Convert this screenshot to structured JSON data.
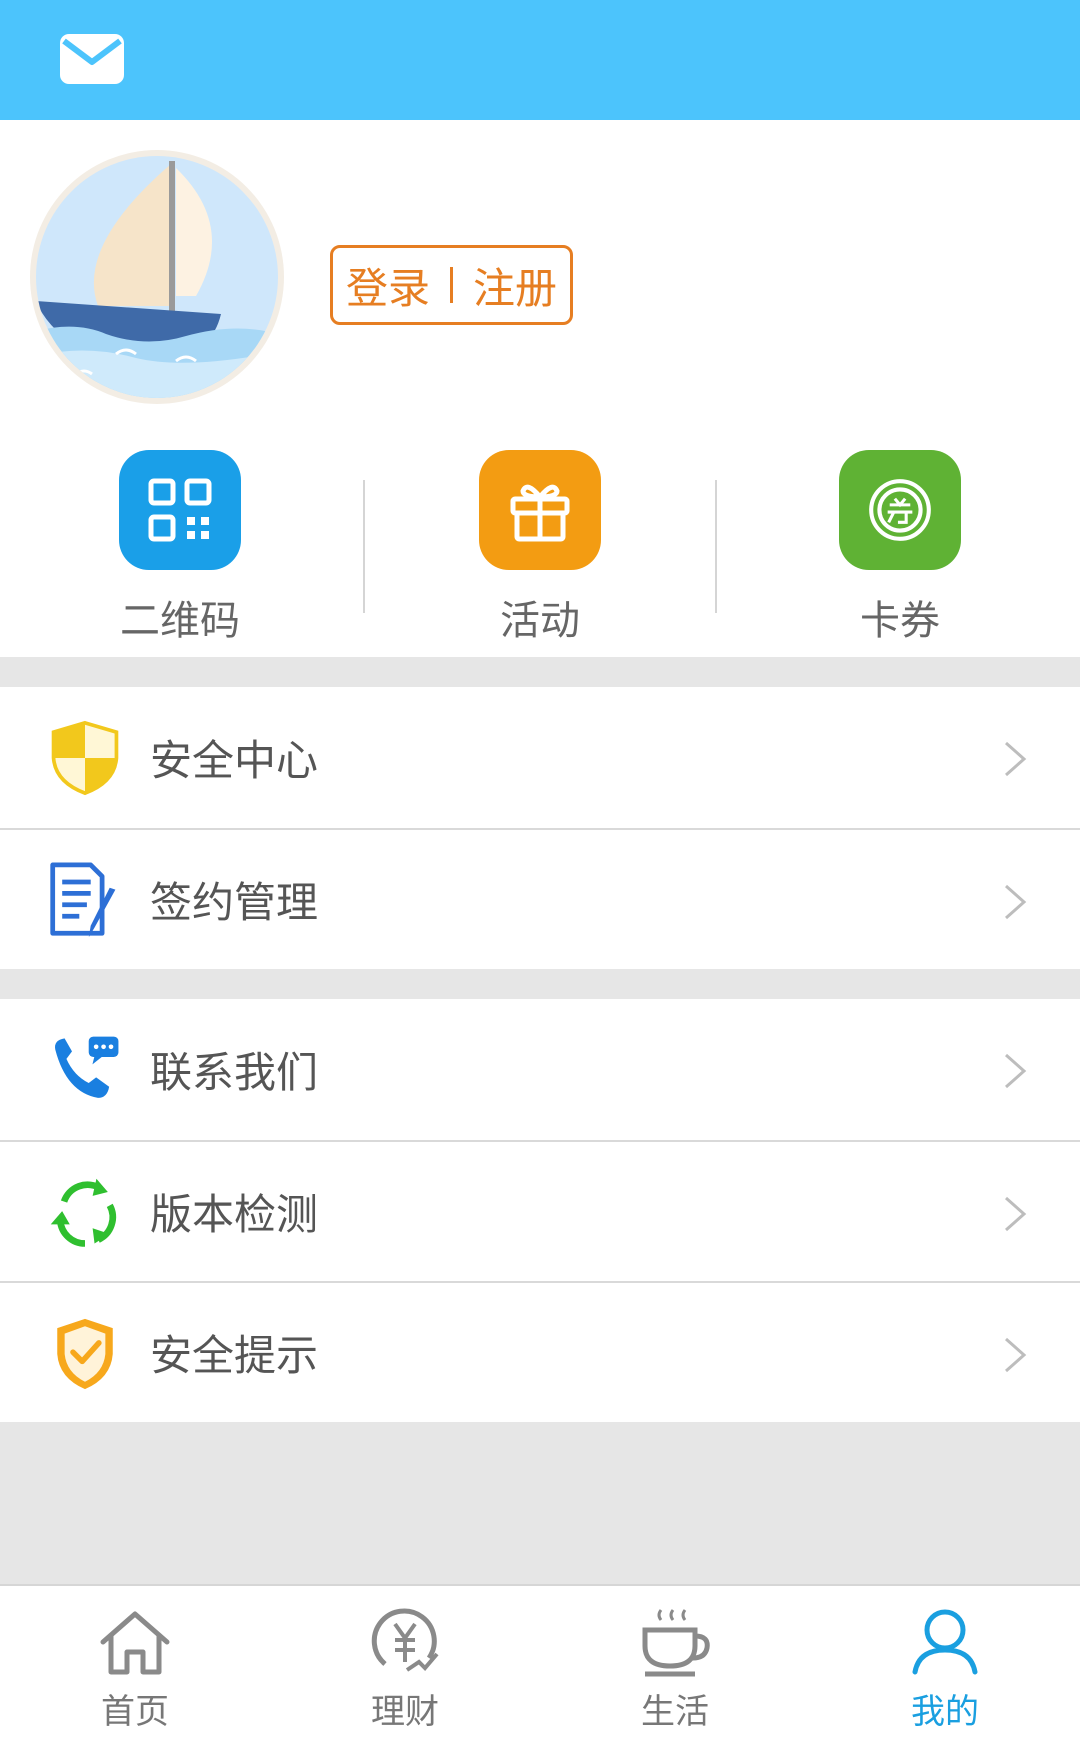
{
  "header": {
    "mail_icon": "mail-icon"
  },
  "profile": {
    "avatar_icon": "sailboat-avatar",
    "login_label": "登录",
    "register_label": "注册",
    "login_color": "#e67e22"
  },
  "quick_actions": [
    {
      "label": "二维码",
      "icon": "qr-code-icon",
      "color": "#1a9fe8"
    },
    {
      "label": "活动",
      "icon": "gift-icon",
      "color": "#f39c12"
    },
    {
      "label": "卡券",
      "icon": "coupon-icon",
      "color": "#5fb234"
    }
  ],
  "menu_group_1": [
    {
      "label": "安全中心",
      "icon": "shield-icon"
    },
    {
      "label": "签约管理",
      "icon": "contract-icon"
    }
  ],
  "menu_group_2": [
    {
      "label": "联系我们",
      "icon": "phone-icon"
    },
    {
      "label": "版本检测",
      "icon": "refresh-icon"
    },
    {
      "label": "安全提示",
      "icon": "shield-check-icon"
    }
  ],
  "tabbar": {
    "items": [
      {
        "label": "首页",
        "icon": "home-icon"
      },
      {
        "label": "理财",
        "icon": "finance-icon"
      },
      {
        "label": "生活",
        "icon": "coffee-icon"
      },
      {
        "label": "我的",
        "icon": "user-icon"
      }
    ],
    "active": "我的",
    "active_color": "#1a9fe0"
  },
  "colors": {
    "header": "#4cc4fc",
    "background": "#e6e6e6"
  }
}
